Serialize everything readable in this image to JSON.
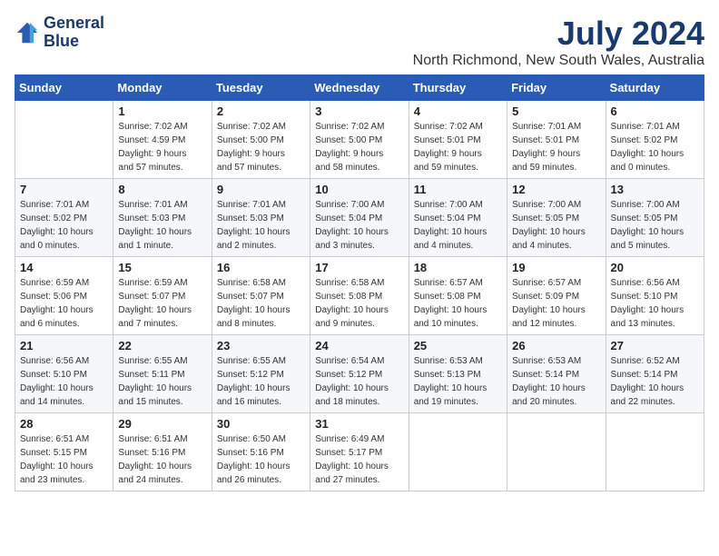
{
  "header": {
    "logo_line1": "General",
    "logo_line2": "Blue",
    "title": "July 2024",
    "subtitle": "North Richmond, New South Wales, Australia"
  },
  "weekdays": [
    "Sunday",
    "Monday",
    "Tuesday",
    "Wednesday",
    "Thursday",
    "Friday",
    "Saturday"
  ],
  "weeks": [
    [
      {
        "day": "",
        "info": []
      },
      {
        "day": "1",
        "info": [
          "Sunrise: 7:02 AM",
          "Sunset: 4:59 PM",
          "Daylight: 9 hours",
          "and 57 minutes."
        ]
      },
      {
        "day": "2",
        "info": [
          "Sunrise: 7:02 AM",
          "Sunset: 5:00 PM",
          "Daylight: 9 hours",
          "and 57 minutes."
        ]
      },
      {
        "day": "3",
        "info": [
          "Sunrise: 7:02 AM",
          "Sunset: 5:00 PM",
          "Daylight: 9 hours",
          "and 58 minutes."
        ]
      },
      {
        "day": "4",
        "info": [
          "Sunrise: 7:02 AM",
          "Sunset: 5:01 PM",
          "Daylight: 9 hours",
          "and 59 minutes."
        ]
      },
      {
        "day": "5",
        "info": [
          "Sunrise: 7:01 AM",
          "Sunset: 5:01 PM",
          "Daylight: 9 hours",
          "and 59 minutes."
        ]
      },
      {
        "day": "6",
        "info": [
          "Sunrise: 7:01 AM",
          "Sunset: 5:02 PM",
          "Daylight: 10 hours",
          "and 0 minutes."
        ]
      }
    ],
    [
      {
        "day": "7",
        "info": [
          "Sunrise: 7:01 AM",
          "Sunset: 5:02 PM",
          "Daylight: 10 hours",
          "and 0 minutes."
        ]
      },
      {
        "day": "8",
        "info": [
          "Sunrise: 7:01 AM",
          "Sunset: 5:03 PM",
          "Daylight: 10 hours",
          "and 1 minute."
        ]
      },
      {
        "day": "9",
        "info": [
          "Sunrise: 7:01 AM",
          "Sunset: 5:03 PM",
          "Daylight: 10 hours",
          "and 2 minutes."
        ]
      },
      {
        "day": "10",
        "info": [
          "Sunrise: 7:00 AM",
          "Sunset: 5:04 PM",
          "Daylight: 10 hours",
          "and 3 minutes."
        ]
      },
      {
        "day": "11",
        "info": [
          "Sunrise: 7:00 AM",
          "Sunset: 5:04 PM",
          "Daylight: 10 hours",
          "and 4 minutes."
        ]
      },
      {
        "day": "12",
        "info": [
          "Sunrise: 7:00 AM",
          "Sunset: 5:05 PM",
          "Daylight: 10 hours",
          "and 4 minutes."
        ]
      },
      {
        "day": "13",
        "info": [
          "Sunrise: 7:00 AM",
          "Sunset: 5:05 PM",
          "Daylight: 10 hours",
          "and 5 minutes."
        ]
      }
    ],
    [
      {
        "day": "14",
        "info": [
          "Sunrise: 6:59 AM",
          "Sunset: 5:06 PM",
          "Daylight: 10 hours",
          "and 6 minutes."
        ]
      },
      {
        "day": "15",
        "info": [
          "Sunrise: 6:59 AM",
          "Sunset: 5:07 PM",
          "Daylight: 10 hours",
          "and 7 minutes."
        ]
      },
      {
        "day": "16",
        "info": [
          "Sunrise: 6:58 AM",
          "Sunset: 5:07 PM",
          "Daylight: 10 hours",
          "and 8 minutes."
        ]
      },
      {
        "day": "17",
        "info": [
          "Sunrise: 6:58 AM",
          "Sunset: 5:08 PM",
          "Daylight: 10 hours",
          "and 9 minutes."
        ]
      },
      {
        "day": "18",
        "info": [
          "Sunrise: 6:57 AM",
          "Sunset: 5:08 PM",
          "Daylight: 10 hours",
          "and 10 minutes."
        ]
      },
      {
        "day": "19",
        "info": [
          "Sunrise: 6:57 AM",
          "Sunset: 5:09 PM",
          "Daylight: 10 hours",
          "and 12 minutes."
        ]
      },
      {
        "day": "20",
        "info": [
          "Sunrise: 6:56 AM",
          "Sunset: 5:10 PM",
          "Daylight: 10 hours",
          "and 13 minutes."
        ]
      }
    ],
    [
      {
        "day": "21",
        "info": [
          "Sunrise: 6:56 AM",
          "Sunset: 5:10 PM",
          "Daylight: 10 hours",
          "and 14 minutes."
        ]
      },
      {
        "day": "22",
        "info": [
          "Sunrise: 6:55 AM",
          "Sunset: 5:11 PM",
          "Daylight: 10 hours",
          "and 15 minutes."
        ]
      },
      {
        "day": "23",
        "info": [
          "Sunrise: 6:55 AM",
          "Sunset: 5:12 PM",
          "Daylight: 10 hours",
          "and 16 minutes."
        ]
      },
      {
        "day": "24",
        "info": [
          "Sunrise: 6:54 AM",
          "Sunset: 5:12 PM",
          "Daylight: 10 hours",
          "and 18 minutes."
        ]
      },
      {
        "day": "25",
        "info": [
          "Sunrise: 6:53 AM",
          "Sunset: 5:13 PM",
          "Daylight: 10 hours",
          "and 19 minutes."
        ]
      },
      {
        "day": "26",
        "info": [
          "Sunrise: 6:53 AM",
          "Sunset: 5:14 PM",
          "Daylight: 10 hours",
          "and 20 minutes."
        ]
      },
      {
        "day": "27",
        "info": [
          "Sunrise: 6:52 AM",
          "Sunset: 5:14 PM",
          "Daylight: 10 hours",
          "and 22 minutes."
        ]
      }
    ],
    [
      {
        "day": "28",
        "info": [
          "Sunrise: 6:51 AM",
          "Sunset: 5:15 PM",
          "Daylight: 10 hours",
          "and 23 minutes."
        ]
      },
      {
        "day": "29",
        "info": [
          "Sunrise: 6:51 AM",
          "Sunset: 5:16 PM",
          "Daylight: 10 hours",
          "and 24 minutes."
        ]
      },
      {
        "day": "30",
        "info": [
          "Sunrise: 6:50 AM",
          "Sunset: 5:16 PM",
          "Daylight: 10 hours",
          "and 26 minutes."
        ]
      },
      {
        "day": "31",
        "info": [
          "Sunrise: 6:49 AM",
          "Sunset: 5:17 PM",
          "Daylight: 10 hours",
          "and 27 minutes."
        ]
      },
      {
        "day": "",
        "info": []
      },
      {
        "day": "",
        "info": []
      },
      {
        "day": "",
        "info": []
      }
    ]
  ]
}
